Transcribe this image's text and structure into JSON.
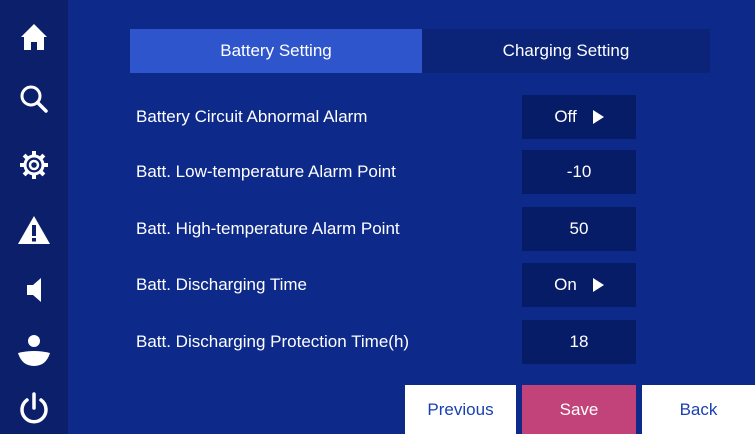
{
  "sidebar": {
    "icons": [
      "home-icon",
      "search-icon",
      "gear-icon",
      "warning-icon",
      "speaker-icon",
      "user-icon",
      "power-icon"
    ]
  },
  "tabs": [
    {
      "label": "Battery Setting",
      "active": true
    },
    {
      "label": "Charging Setting",
      "active": false
    }
  ],
  "settings": [
    {
      "label": "Battery Circuit Abnormal Alarm",
      "value": "Off",
      "has_arrow": true
    },
    {
      "label": "Batt. Low-temperature Alarm Point",
      "value": "-10",
      "has_arrow": false
    },
    {
      "label": "Batt. High-temperature Alarm Point",
      "value": "50",
      "has_arrow": false
    },
    {
      "label": "Batt. Discharging Time",
      "value": "On",
      "has_arrow": true
    },
    {
      "label": "Batt. Discharging Protection Time(h)",
      "value": "18",
      "has_arrow": false
    }
  ],
  "buttons": {
    "previous": "Previous",
    "save": "Save",
    "back": "Back"
  },
  "colors": {
    "background": "#0d2a8a",
    "sidebar": "#0b1f6b",
    "active_tab": "#2e55cc",
    "inactive_tab": "#0b2478",
    "value_box": "#071c66",
    "save_button": "#c2437a"
  }
}
